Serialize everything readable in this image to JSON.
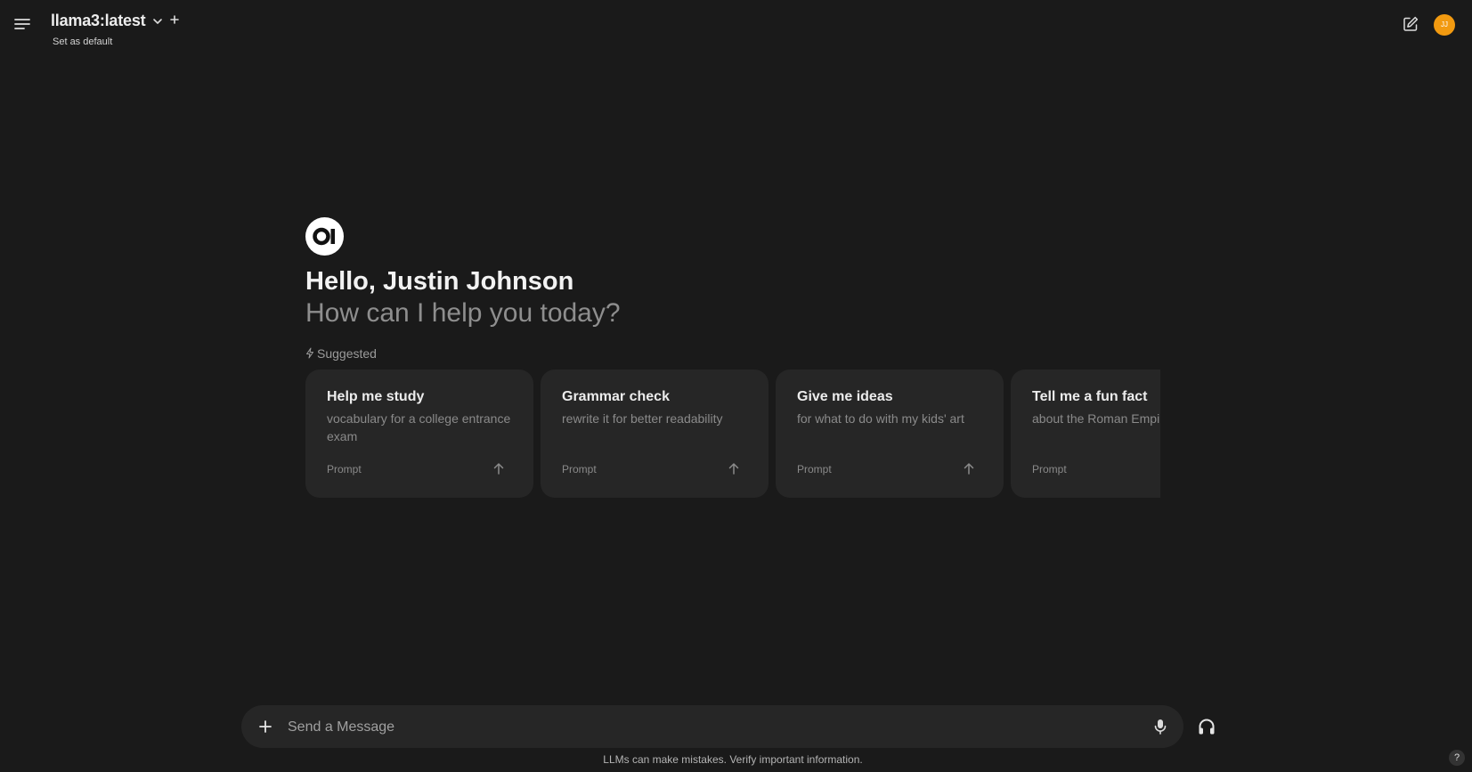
{
  "header": {
    "model_name": "llama3:latest",
    "set_default_label": "Set as default",
    "user_initials": "JJ",
    "avatar_color": "#f29a10"
  },
  "greeting": {
    "hello": "Hello, Justin Johnson",
    "subtitle": "How can I help you today?"
  },
  "suggested": {
    "label": "Suggested",
    "cards": [
      {
        "title": "Help me study",
        "subtitle": "vocabulary for a college entrance exam",
        "tag": "Prompt"
      },
      {
        "title": "Grammar check",
        "subtitle": "rewrite it for better readability",
        "tag": "Prompt"
      },
      {
        "title": "Give me ideas",
        "subtitle": "for what to do with my kids' art",
        "tag": "Prompt"
      },
      {
        "title": "Tell me a fun fact",
        "subtitle": "about the Roman Empire",
        "tag": "Prompt"
      }
    ]
  },
  "composer": {
    "placeholder": "Send a Message"
  },
  "footer": {
    "disclaimer": "LLMs can make mistakes. Verify important information.",
    "help_label": "?"
  },
  "icons": {
    "menu": "menu-icon",
    "chevron": "chevron-down-icon",
    "add_model": "plus-icon",
    "new_chat": "edit-icon",
    "logo": "open-webui-logo",
    "suggested": "bolt-icon",
    "send_prompt": "arrow-up-icon",
    "attach": "plus-icon",
    "mic": "microphone-icon",
    "voice": "headphones-icon"
  }
}
